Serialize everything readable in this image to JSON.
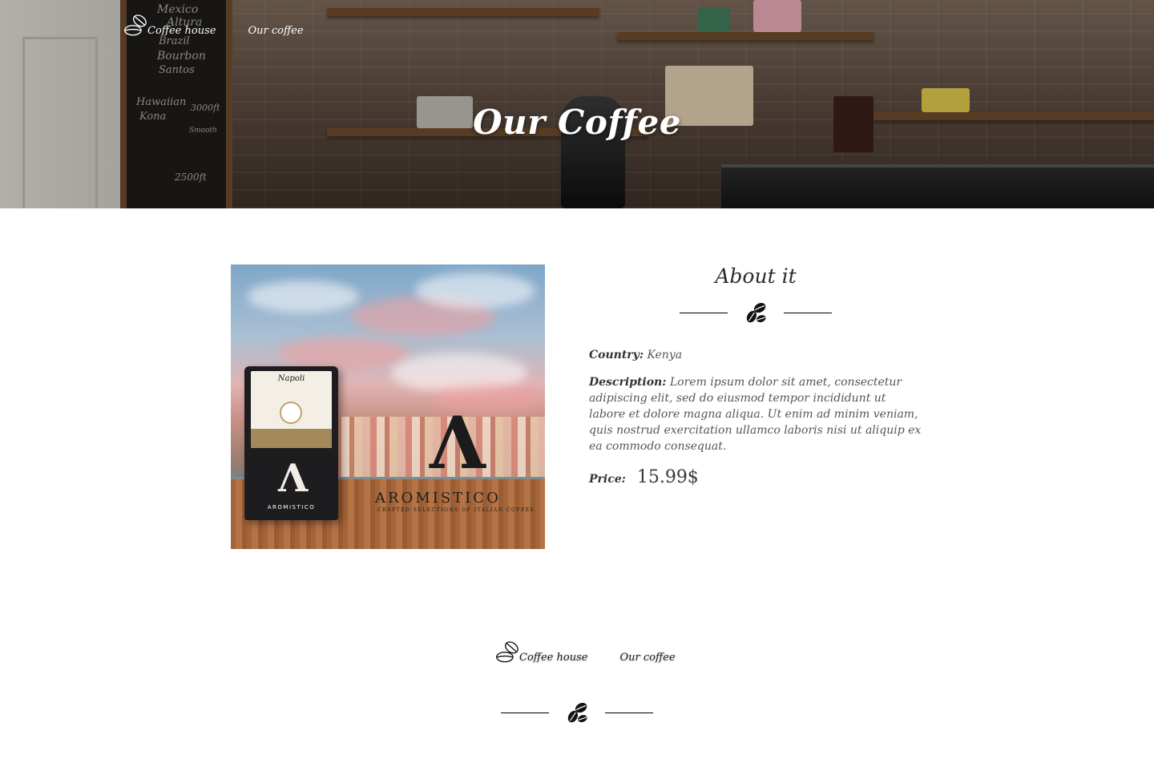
{
  "header": {
    "logo_label": "Coffee house",
    "nav_link": "Our coffee",
    "title": "Our Coffee"
  },
  "product": {
    "image": {
      "bag_name": "Napoli",
      "bag_brand": "AROMISTICO",
      "brand": "AROMISTICO",
      "brand_tagline": "CRAFTED SELECTIONS OF ITALIAN COFFEE"
    },
    "about_title": "About it",
    "country_label": "Country:",
    "country_value": "Kenya",
    "description_label": "Description:",
    "description_value": "Lorem ipsum dolor sit amet, consectetur adipiscing elit, sed do eiusmod tempor incididunt ut labore et dolore magna aliqua. Ut enim ad minim veniam, quis nostrud exercitation ullamco laboris nisi ut aliquip ex ea commodo consequat.",
    "price_label": "Price:",
    "price_value": "15.99$"
  },
  "footer": {
    "logo_label": "Coffee house",
    "nav_link": "Our coffee"
  },
  "icons": {
    "logo": "coffee-bean-outline-icon",
    "divider": "coffee-beans-icon"
  },
  "colors": {
    "hero_text": "#ffffff",
    "body_text": "#2a2a2a",
    "divider": "#000000"
  }
}
